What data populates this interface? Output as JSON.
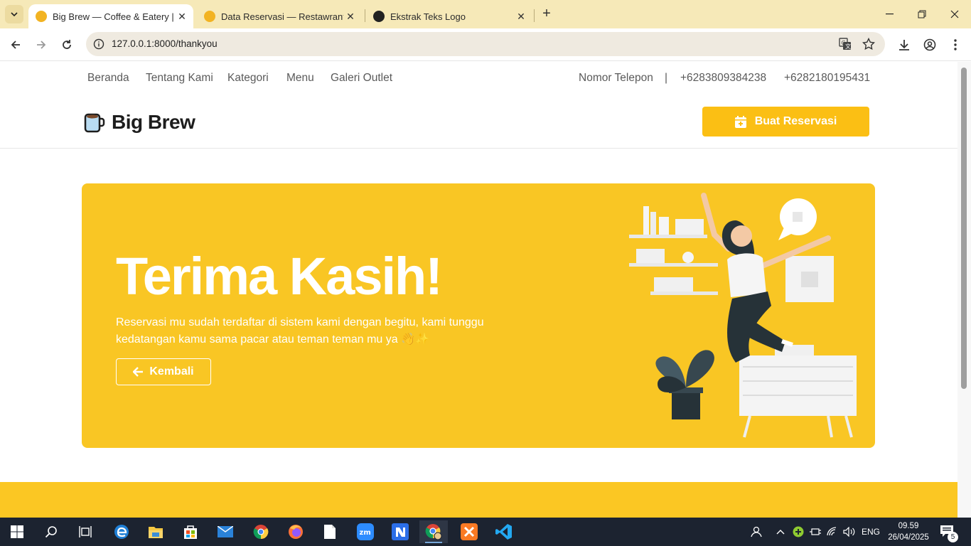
{
  "browser": {
    "tabs": [
      {
        "title": "Big Brew — Coffee & Eatery | R",
        "active": true
      },
      {
        "title": "Data Reservasi — Restawrant",
        "active": false
      },
      {
        "title": "Ekstrak Teks Logo",
        "active": false
      }
    ],
    "url": "127.0.0.1:8000/thankyou"
  },
  "site": {
    "nav": [
      "Beranda",
      "Tentang Kami",
      "Kategori",
      "Menu",
      "Galeri Outlet"
    ],
    "phone_label": "Nomor Telepon",
    "phone_separator": "|",
    "phones": [
      "+6283809384238",
      "+6282180195431"
    ],
    "brand_name": "Big Brew",
    "reserve_button": "Buat Reservasi"
  },
  "hero": {
    "title": "Terima Kasih!",
    "message": "Reservasi mu sudah terdaftar di sistem kami dengan begitu, kami tunggu kedatangan kamu sama pacar atau teman teman mu ya 👋✨",
    "back_button": "Kembali"
  },
  "taskbar": {
    "language": "ENG",
    "time": "09.59",
    "date": "26/04/2025",
    "notifications": "5"
  },
  "colors": {
    "accent": "#fbbf14",
    "hero_bg": "#f9c624",
    "tabbar_bg": "#f6e9b8"
  }
}
